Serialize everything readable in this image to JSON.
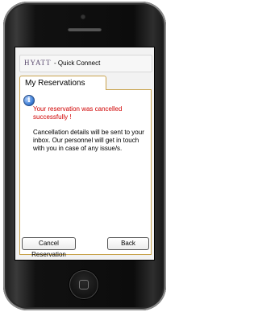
{
  "header": {
    "logo_text": "HYATT",
    "app_name": "- Quick Connect"
  },
  "tab": {
    "label": "My Reservations"
  },
  "message": {
    "icon": "info-icon",
    "status_text": "Your reservation was cancelled successfully !",
    "details_text": "Cancellation details will be sent to your inbox. Our personnel will get in touch with you in case of any issue/s."
  },
  "buttons": {
    "cancel_label": "Cancel Reservation",
    "back_label": "Back"
  },
  "colors": {
    "status_red": "#d00000",
    "tab_border": "#c8a24c"
  }
}
